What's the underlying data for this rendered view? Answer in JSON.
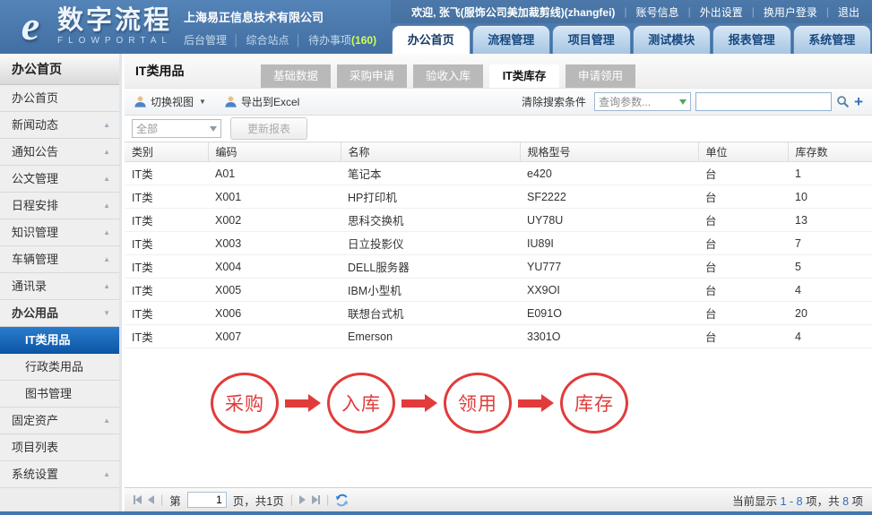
{
  "colors": {
    "header_blue": "#4a78ab",
    "selected_item_blue": "#0d56a6",
    "flow_red": "#e23b3b",
    "number_link_blue": "#2e6eb8",
    "todo_count_green": "#d3ff4d"
  },
  "header": {
    "logo_icon": "e",
    "logo_title": "数字流程",
    "logo_subtitle": "FLOWPORTAL",
    "company": "上海易正信息技术有限公司",
    "admin_links": [
      "后台管理",
      "综合站点"
    ],
    "todo_label": "待办事项",
    "todo_count": "(160)",
    "welcome": "欢迎, 张飞(服饰公司美加裁剪线)(zhangfei)",
    "user_links": [
      "账号信息",
      "外出设置",
      "换用户登录",
      "退出"
    ],
    "nav_tabs": [
      {
        "label": "办公首页",
        "active": true
      },
      {
        "label": "流程管理",
        "active": false
      },
      {
        "label": "项目管理",
        "active": false
      },
      {
        "label": "测试模块",
        "active": false
      },
      {
        "label": "报表管理",
        "active": false
      },
      {
        "label": "系统管理",
        "active": false
      }
    ]
  },
  "sidebar": {
    "title": "办公首页",
    "items": [
      {
        "label": "办公首页",
        "arrow": null,
        "child": false,
        "selected": false,
        "bold": false
      },
      {
        "label": "新闻动态",
        "arrow": "up",
        "child": false,
        "selected": false,
        "bold": false
      },
      {
        "label": "通知公告",
        "arrow": "up",
        "child": false,
        "selected": false,
        "bold": false
      },
      {
        "label": "公文管理",
        "arrow": "up",
        "child": false,
        "selected": false,
        "bold": false
      },
      {
        "label": "日程安排",
        "arrow": "up",
        "child": false,
        "selected": false,
        "bold": false
      },
      {
        "label": "知识管理",
        "arrow": "up",
        "child": false,
        "selected": false,
        "bold": false
      },
      {
        "label": "车辆管理",
        "arrow": "up",
        "child": false,
        "selected": false,
        "bold": false
      },
      {
        "label": "通讯录",
        "arrow": "up",
        "child": false,
        "selected": false,
        "bold": false
      },
      {
        "label": "办公用品",
        "arrow": "down",
        "child": false,
        "selected": false,
        "bold": true
      },
      {
        "label": "IT类用品",
        "arrow": null,
        "child": true,
        "selected": true,
        "bold": true
      },
      {
        "label": "行政类用品",
        "arrow": null,
        "child": true,
        "selected": false,
        "bold": false
      },
      {
        "label": "图书管理",
        "arrow": null,
        "child": true,
        "selected": false,
        "bold": false
      },
      {
        "label": "固定资产",
        "arrow": "up",
        "child": false,
        "selected": false,
        "bold": false
      },
      {
        "label": "项目列表",
        "arrow": null,
        "child": false,
        "selected": false,
        "bold": false
      },
      {
        "label": "系统设置",
        "arrow": "up",
        "child": false,
        "selected": false,
        "bold": false
      }
    ]
  },
  "main": {
    "page_title": "IT类用品",
    "tabs": [
      {
        "label": "基础数据",
        "active": false
      },
      {
        "label": "采购申请",
        "active": false
      },
      {
        "label": "验收入库",
        "active": false
      },
      {
        "label": "IT类库存",
        "active": true
      },
      {
        "label": "申请领用",
        "active": false
      }
    ],
    "toolbar": {
      "switch_view": "切换视图",
      "export_excel": "导出到Excel",
      "clear_search": "清除搜索条件",
      "query_param_placeholder": "查询参数...",
      "search_value": ""
    },
    "filter": {
      "category_value": "全部",
      "update_button": "更新报表"
    },
    "table": {
      "columns": [
        "类别",
        "编码",
        "名称",
        "规格型号",
        "单位",
        "库存数"
      ],
      "rows": [
        [
          "IT类",
          "A01",
          "笔记本",
          "e420",
          "台",
          "1"
        ],
        [
          "IT类",
          "X001",
          "HP打印机",
          "SF2222",
          "台",
          "10"
        ],
        [
          "IT类",
          "X002",
          "思科交换机",
          "UY78U",
          "台",
          "13"
        ],
        [
          "IT类",
          "X003",
          "日立投影仪",
          "IU89I",
          "台",
          "7"
        ],
        [
          "IT类",
          "X004",
          "DELL服务器",
          "YU777",
          "台",
          "5"
        ],
        [
          "IT类",
          "X005",
          "IBM小型机",
          "XX9OI",
          "台",
          "4"
        ],
        [
          "IT类",
          "X006",
          "联想台式机",
          "E091O",
          "台",
          "20"
        ],
        [
          "IT类",
          "X007",
          "Emerson",
          "3301O",
          "台",
          "4"
        ]
      ]
    },
    "flow_steps": [
      "采购",
      "入库",
      "领用",
      "库存"
    ],
    "pagination": {
      "page_prefix": "第",
      "page_value": "1",
      "page_suffix": "页，共1页",
      "summary_parts": [
        "当前显示 ",
        "1 - 8",
        " 项，共 ",
        "8",
        " 项"
      ]
    }
  }
}
